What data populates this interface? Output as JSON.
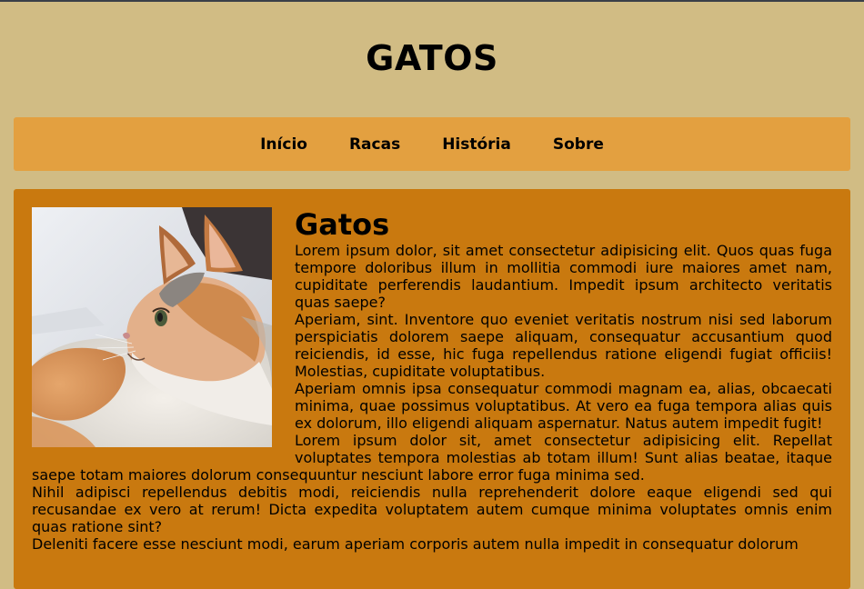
{
  "header": {
    "title": "GATOS"
  },
  "nav": {
    "items": [
      {
        "label": "Início"
      },
      {
        "label": "Racas"
      },
      {
        "label": "História"
      },
      {
        "label": "Sobre"
      }
    ]
  },
  "article": {
    "image": {
      "alt": "cat-photo"
    },
    "heading": "Gatos",
    "paragraphs": [
      "Lorem ipsum dolor, sit amet consectetur adipisicing elit. Quos quas fuga tempore doloribus illum in mollitia commodi iure maiores amet nam, cupiditate perferendis laudantium. Impedit ipsum architecto veritatis quas saepe?",
      "Aperiam, sint. Inventore quo eveniet veritatis nostrum nisi sed laborum perspiciatis dolorem saepe aliquam, consequatur accusantium quod reiciendis, id esse, hic fuga repellendus ratione eligendi fugiat officiis! Molestias, cupiditate voluptatibus.",
      "Aperiam omnis ipsa consequatur commodi magnam ea, alias, obcaecati minima, quae possimus voluptatibus. At vero ea fuga tempora alias quis ex dolorum, illo eligendi aliquam aspernatur. Natus autem impedit fugit!",
      "Lorem ipsum dolor sit, amet consectetur adipisicing elit. Repellat voluptates tempora molestias ab totam illum! Sunt alias beatae, itaque saepe totam maiores dolorum consequuntur nesciunt labore error fuga minima sed.",
      "Nihil adipisci repellendus debitis modi, reiciendis nulla reprehenderit dolore eaque eligendi sed qui recusandae ex vero at rerum! Dicta expedita voluptatem autem cumque minima voluptates omnis enim quas ratione sint?",
      "Deleniti facere esse nesciunt modi, earum aperiam corporis autem nulla impedit in consequatur dolorum"
    ]
  }
}
